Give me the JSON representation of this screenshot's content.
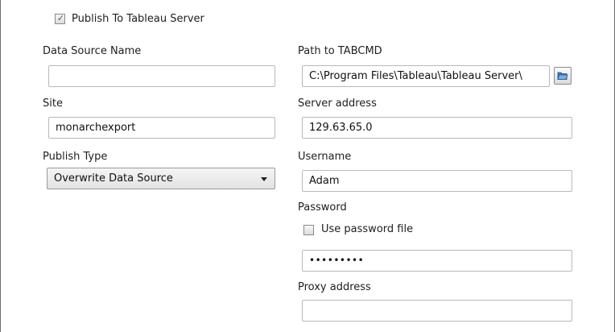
{
  "publish": {
    "checkbox_checked": true,
    "label": "Publish To Tableau Server"
  },
  "left": {
    "data_source_name_label": "Data Source Name",
    "data_source_name_value": "",
    "site_label": "Site",
    "site_value": "monarchexport",
    "publish_type_label": "Publish Type",
    "publish_type_value": "Overwrite Data Source"
  },
  "right": {
    "tabcmd_label": "Path to TABCMD",
    "tabcmd_value": "C:\\Program Files\\Tableau\\Tableau Server\\",
    "server_label": "Server address",
    "server_value": "129.63.65.0",
    "username_label": "Username",
    "username_value": "Adam",
    "password_label": "Password",
    "use_password_file_label": "Use password file",
    "use_password_file_checked": false,
    "password_value": "•••••••••",
    "proxy_label": "Proxy address",
    "proxy_value": ""
  },
  "icons": {
    "browse": "folder-open-icon",
    "dropdown": "chevron-down-icon",
    "checked": "check-icon"
  },
  "colors": {
    "border": "#b9b9b9",
    "folder_icon": "#2f6fb3"
  }
}
